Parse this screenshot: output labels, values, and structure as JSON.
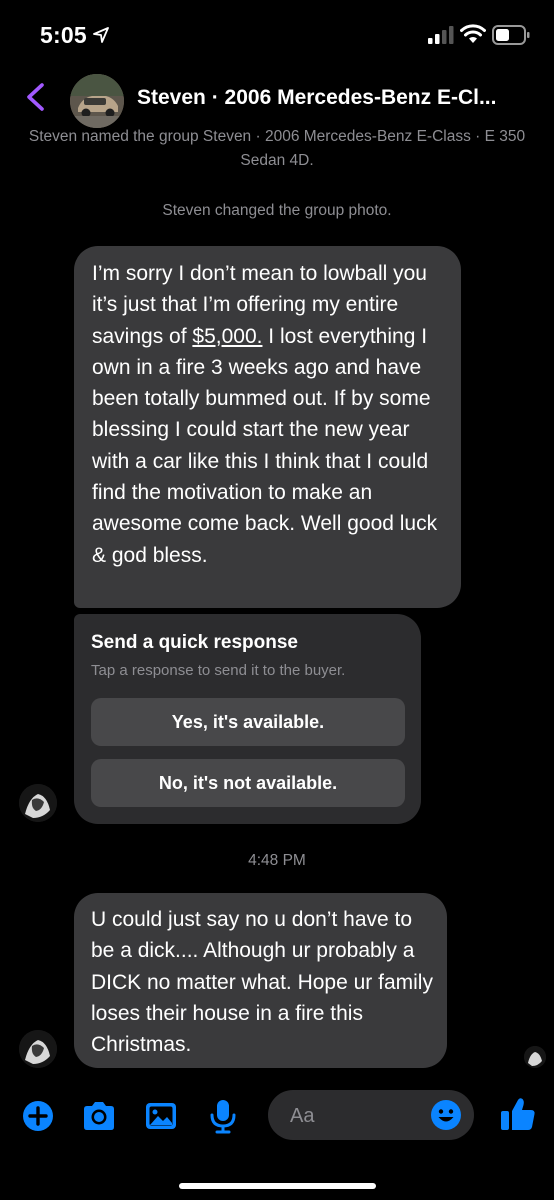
{
  "status_bar": {
    "time": "5:05"
  },
  "header": {
    "title": "Steven · 2006 Mercedes-Benz E-Cl..."
  },
  "system_messages": {
    "group_named": "Steven named the group Steven · 2006 Mercedes-Benz E-Class · E 350 Sedan 4D.",
    "photo_changed": "Steven changed the group photo."
  },
  "messages": [
    {
      "text_before": "I’m sorry I don’t mean to lowball you it’s just that I’m offering my entire savings of ",
      "link": "$5,000.",
      "text_after": " I lost everything I own in a fire 3 weeks ago and have been totally bummed out. If by some blessing I could start the new year with a car like this I think that I could find the motivation to make an awesome come back. Well good luck & god bless."
    },
    {
      "text": "U could just say no u don’t have to be a dick.... Although ur probably a DICK no matter what. Hope ur family loses their house in a fire this Christmas."
    }
  ],
  "quick_response": {
    "title": "Send a quick response",
    "subtitle": "Tap a response to send it to the buyer.",
    "options": [
      "Yes, it's available.",
      "No, it's not available."
    ]
  },
  "timestamp": "4:48 PM",
  "composer": {
    "placeholder": "Aa"
  },
  "colors": {
    "accent": "#0a84ff",
    "back_arrow": "#a259ff",
    "bubble": "#3a3a3c"
  },
  "icons": [
    "location-arrow-icon",
    "signal-icon",
    "wifi-icon",
    "battery-icon",
    "back-chevron-icon",
    "plus-icon",
    "camera-icon",
    "image-icon",
    "microphone-icon",
    "emoji-icon",
    "thumbs-up-icon"
  ]
}
